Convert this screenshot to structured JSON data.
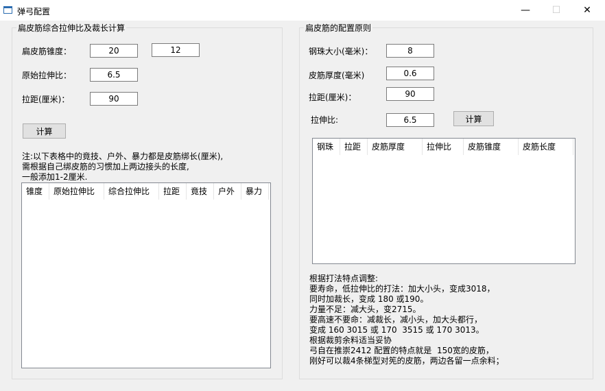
{
  "window": {
    "title": "弹弓配置",
    "minimize": "—",
    "maximize": "☐",
    "close": "✕"
  },
  "left": {
    "group_title": "扁皮筋综合拉伸比及裁长计算",
    "taper_label": "扁皮筋锥度：",
    "taper_value_1": "20",
    "taper_value_2": "12",
    "ratio_label": "原始拉伸比：",
    "ratio_value": "6.5",
    "draw_label": "拉距(厘米)：",
    "draw_value": "90",
    "calc_button": "计算",
    "note": [
      "注:以下表格中的竟技、户外、暴力都是皮筋绑长(厘米),",
      "需根据自己绑皮筋的习惯加上两边接头的长度,",
      "一般添加1-2厘米."
    ],
    "table_columns": [
      "锥度",
      "原始拉伸比",
      "综合拉伸比",
      "拉距",
      "竟技",
      "户外",
      "暴力"
    ]
  },
  "right": {
    "group_title": "扁皮筋的配置原则",
    "ball_label": "钢珠大小(毫米)：",
    "ball_value": "8",
    "thick_label": "皮筋厚度(毫米)",
    "thick_value": "0.6",
    "draw_label": "拉距(厘米)：",
    "draw_value": "90",
    "ratio_label": "拉伸比:",
    "ratio_value": "6.5",
    "calc_button": "计算",
    "table_columns": [
      "钢珠",
      "拉距",
      "皮筋厚度",
      "拉伸比",
      "皮筋锥度",
      "皮筋长度"
    ],
    "tips": [
      "根据打法特点调整:",
      "要寿命，低拉伸比的打法：加大小头，变成3018，",
      "同时加裁长，变成 180 或190。",
      "力量不足：减大头，变2715。",
      "要高速不要命：减裁长，减小头，加大头都行，",
      "变成 160 3015 或 170  3515 或 170 3013。",
      "根据裁剪余料适当妥协",
      "弓自在推崇2412 配置的特点就是  150宽的皮筋，",
      "刚好可以裁4条梯型对筅的皮筋，两边各留一点余料；"
    ]
  }
}
